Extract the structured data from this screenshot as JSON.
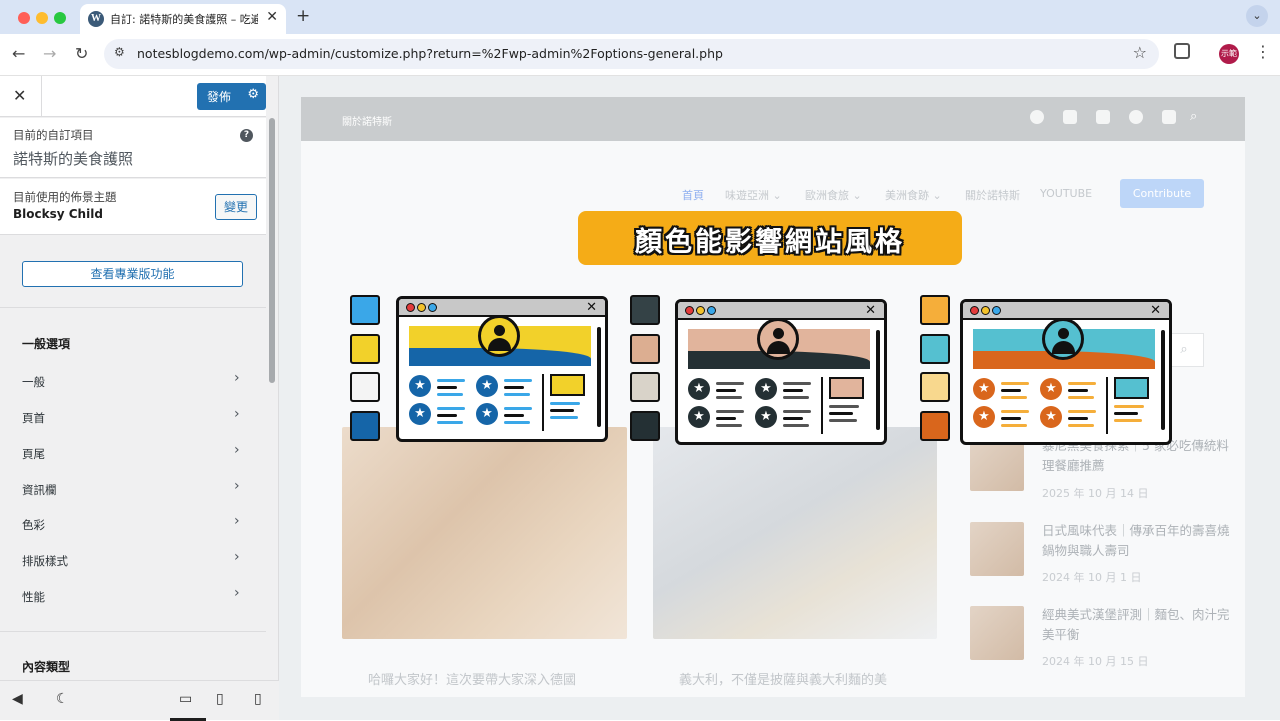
{
  "browser": {
    "tab_title": "自訂: 諾特斯的美食護照 – 吃遍",
    "url": "notesblogdemo.com/wp-admin/customize.php?return=%2Fwp-admin%2Foptions-general.php",
    "profile": "示範"
  },
  "sidebar": {
    "publish_label": "發佈",
    "current_custom_label": "目前的自訂項目",
    "current_custom_title": "諾特斯的美食護照",
    "theme_label": "目前使用的佈景主題",
    "theme_name": "Blocksy Child",
    "change_label": "變更",
    "pro_label": "查看專業版功能",
    "section_general": "一般選項",
    "items": [
      {
        "label": "一般"
      },
      {
        "label": "頁首"
      },
      {
        "label": "頁尾"
      },
      {
        "label": "資訊欄"
      },
      {
        "label": "色彩"
      },
      {
        "label": "排版樣式"
      },
      {
        "label": "性能"
      }
    ],
    "section_content": "內容類型"
  },
  "site": {
    "top_about": "關於諾特斯",
    "nav": [
      "首頁",
      "味遊亞洲 ⌄",
      "歐洲食旅 ⌄",
      "美洲食跡 ⌄",
      "關於諾特斯",
      "YOUTUBE"
    ],
    "contribute": "Contribute",
    "posts": [
      {
        "title": "哈囉大家好！這次要帶大家深入德國"
      },
      {
        "title": "義大利，不僅是披薩與義大利麵的美"
      }
    ],
    "recent": [
      {
        "title": "暴尼黑美食探索｜5 家必吃傳統料理餐廳推薦",
        "date": "2025 年 10 月 14 日"
      },
      {
        "title": "日式風味代表｜傳承百年的壽喜燒鍋物與職人壽司",
        "date": "2024 年 10 月 1 日"
      },
      {
        "title": "經典美式漢堡評測｜麵包、肉汁完美平衡",
        "date": "2024 年 10 月 15 日"
      }
    ]
  },
  "overlay": {
    "banner_text": "顏色能影響網站風格",
    "palettes": [
      {
        "colors": [
          "#3aa7e8",
          "#f2d12a",
          "#f4f4f4",
          "#1565a8"
        ],
        "band": "#f2d12a",
        "wave": "#1565a8",
        "accent": "#1565a8",
        "line": "#3aa7e8"
      },
      {
        "colors": [
          "#344246",
          "#dcae91",
          "#d9d3c9",
          "#243034"
        ],
        "band": "#e1b49c",
        "wave": "#243034",
        "accent": "#243034",
        "line": "#555555"
      },
      {
        "colors": [
          "#f5ae3a",
          "#55c0d0",
          "#f8d88e",
          "#d9661c"
        ],
        "band": "#55c0d0",
        "wave": "#d9661c",
        "accent": "#d9661c",
        "line": "#f5ae3a"
      }
    ]
  }
}
